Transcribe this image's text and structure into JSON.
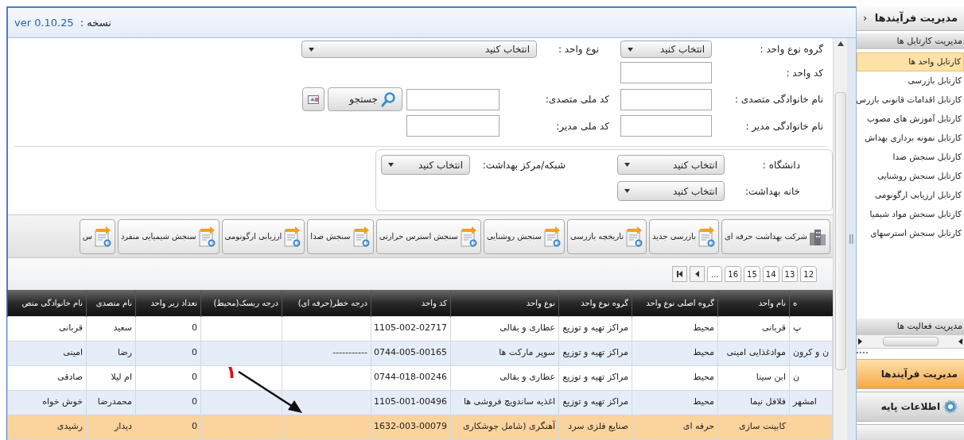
{
  "title_bar": {
    "version_label": "نسخه :",
    "version": "ver 0.10.25"
  },
  "form": {
    "fields": [
      {
        "kind": "select",
        "label": "گروه نوع واحد :",
        "value": "انتخاب کنید"
      },
      {
        "kind": "select",
        "label": "نوع واحد :",
        "value": "انتخاب کنید"
      },
      {
        "kind": "input",
        "label": "کد واحد :"
      },
      {
        "kind": "input",
        "label": "نام خانوادگی متصدی :"
      },
      {
        "kind": "input",
        "label": "کد ملی متصدی:"
      },
      {
        "kind": "input",
        "label": "نام خانوادگی مدیر :"
      },
      {
        "kind": "input",
        "label": "کد ملی مدیر:"
      }
    ],
    "search_button": "جستجو",
    "location_fields": [
      {
        "kind": "select",
        "label": "دانشگاه :",
        "value": "انتخاب کنید"
      },
      {
        "kind": "select",
        "label": "شبکه/مرکز بهداشت:",
        "value": "انتخاب کنید"
      },
      {
        "kind": "select",
        "label": "خانه بهداشت:",
        "value": "انتخاب کنید"
      }
    ]
  },
  "toolbar": [
    {
      "kind": "building",
      "label": "شرکت بهداشت حرفه ای"
    },
    {
      "kind": "report",
      "label": "بازرسی جدید"
    },
    {
      "kind": "report",
      "label": "تاریخچه بازرسی"
    },
    {
      "kind": "report",
      "label": "سنجش روشنایی"
    },
    {
      "kind": "report",
      "label": "سنجش استرس حرارتی"
    },
    {
      "kind": "report",
      "label": "سنجش صدا"
    },
    {
      "kind": "report",
      "label": "ارزیابی ارگونومی"
    },
    {
      "kind": "report",
      "label": "سنجش شیمیایی منفرد"
    },
    {
      "kind": "report",
      "label": "س"
    }
  ],
  "pager": {
    "pages": [
      "12",
      "13",
      "14",
      "15",
      "16"
    ],
    "ellipsis": "..."
  },
  "table": {
    "columns": [
      "ه",
      "نام واحد",
      "گروه اصلی نوع واحد",
      "گروه نوع واحد",
      "نوع واحد",
      "کد واحد",
      "درجه خطر(حرفه ای)",
      "درجه ریسک(محیط)",
      "تعداد زیر واحد",
      "نام متصدی",
      "نام خانوادگی متص"
    ],
    "rows": [
      {
        "selected": false,
        "cells": [
          "پ",
          "قربانی",
          "محیط",
          "مراکز تهیه و توزیع",
          "عطاری و بقالی",
          "1105-002-02717",
          "",
          "",
          "0",
          "سعید",
          "قربانی"
        ]
      },
      {
        "selected": false,
        "cells": [
          "ن و کرون",
          "موادغذایی امینی",
          "محیط",
          "مراکز تهیه و توزیع",
          "سوپر مارکت ها",
          "0744-005-00165",
          "-----------",
          "",
          "0",
          "رضا",
          "امینی"
        ]
      },
      {
        "selected": false,
        "cells": [
          "ن",
          "ابن سینا",
          "محیط",
          "مراکز تهیه و توزیع",
          "عطاری و بقالی",
          "0744-018-00246",
          "",
          "",
          "0",
          "ام لیلا",
          "صادقی"
        ]
      },
      {
        "selected": false,
        "cells": [
          "امشهر",
          "فلافل نیما",
          "محیط",
          "مراکز تهیه و توزیع",
          "اغذیه ساندویچ فروشی ها",
          "1105-001-00496",
          "",
          "",
          "0",
          "محمدرضا",
          "خوش خواه"
        ]
      },
      {
        "selected": true,
        "cells": [
          "",
          "کابینت سازی",
          "حرفه ای",
          "صنایع فلزی سرد",
          "آهنگری (شامل جوشکاری",
          "1632-003-00079",
          "",
          "",
          "0",
          "دیدار",
          "رشیدی"
        ]
      }
    ]
  },
  "annotation": {
    "marker": "١"
  },
  "sidebar": {
    "title": "مدیریت فرآیندها",
    "collapse": "‹",
    "section_title": "مدیریت کارتابل ها",
    "items": [
      {
        "label": "کارتابل واحد ها",
        "selected": true
      },
      {
        "label": "کارتابل بازرسی",
        "selected": false
      },
      {
        "label": "کارتابل اقدامات قانونی بازرس",
        "selected": false
      },
      {
        "label": "کارتابل آموزش های مصوب",
        "selected": false
      },
      {
        "label": "کارتابل نمونه برداری بهداش",
        "selected": false
      },
      {
        "label": "کارتابل سنجش صدا",
        "selected": false
      },
      {
        "label": "کارتابل سنجش روشنایی",
        "selected": false
      },
      {
        "label": "کارتابل ارزیابی ارگونومی",
        "selected": false
      },
      {
        "label": "کارتابل سنجش مواد شیمیا",
        "selected": false
      },
      {
        "label": "کارتابل سنجش استرسهای",
        "selected": false
      }
    ],
    "second_section_title": "مدیریت فعالیت ها",
    "nav": [
      {
        "kind": "plain",
        "label": "مدیریت فرآیندها",
        "selected": true
      },
      {
        "kind": "gear",
        "label": "اطلاعات پایه",
        "selected": false
      }
    ]
  }
}
